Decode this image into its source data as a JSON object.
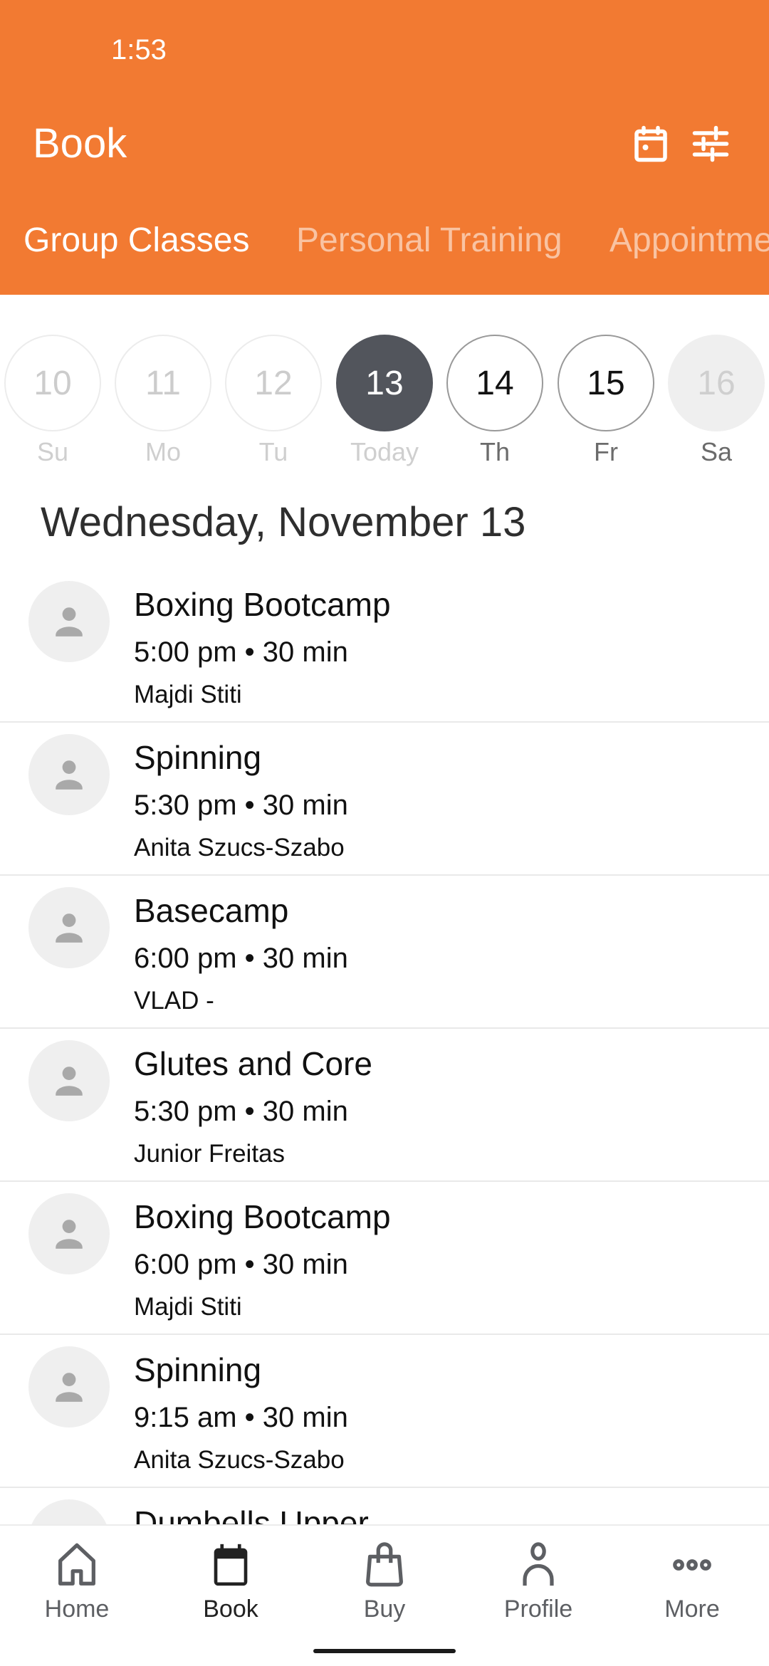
{
  "status_bar": {
    "time": "1:53"
  },
  "header": {
    "title": "Book",
    "icons": [
      "calendar-icon",
      "filter-sliders-icon"
    ],
    "accent_color": "#f27a32"
  },
  "tabs": [
    {
      "label": "Group Classes",
      "active": true
    },
    {
      "label": "Personal Training",
      "active": false
    },
    {
      "label": "Appointme",
      "active": false
    }
  ],
  "week": [
    {
      "num": "10",
      "label": "Su",
      "state": "past"
    },
    {
      "num": "11",
      "label": "Mo",
      "state": "past"
    },
    {
      "num": "12",
      "label": "Tu",
      "state": "past"
    },
    {
      "num": "13",
      "label": "Today",
      "state": "selected"
    },
    {
      "num": "14",
      "label": "Th",
      "state": "future"
    },
    {
      "num": "15",
      "label": "Fr",
      "state": "future"
    },
    {
      "num": "16",
      "label": "Sa",
      "state": "unavailable"
    }
  ],
  "date_heading": "Wednesday, November 13",
  "classes": [
    {
      "name": "Boxing Bootcamp",
      "time": "5:00 pm • 30 min",
      "instructor": "Majdi Stiti"
    },
    {
      "name": "Spinning",
      "time": "5:30 pm • 30 min",
      "instructor": "Anita Szucs-Szabo"
    },
    {
      "name": "Basecamp",
      "time": "6:00 pm • 30 min",
      "instructor": "VLAD -"
    },
    {
      "name": "Glutes and Core",
      "time": "5:30 pm • 30 min",
      "instructor": "Junior Freitas"
    },
    {
      "name": "Boxing Bootcamp",
      "time": "6:00 pm • 30 min",
      "instructor": "Majdi Stiti"
    },
    {
      "name": "Spinning",
      "time": "9:15 am • 30 min",
      "instructor": "Anita Szucs-Szabo"
    },
    {
      "name": "Dumbells Upper",
      "time": "",
      "instructor": ""
    }
  ],
  "bottom_nav": [
    {
      "label": "Home",
      "icon": "home-icon",
      "active": false
    },
    {
      "label": "Book",
      "icon": "calendar-icon",
      "active": true
    },
    {
      "label": "Buy",
      "icon": "shopping-bag-icon",
      "active": false
    },
    {
      "label": "Profile",
      "icon": "person-icon",
      "active": false
    },
    {
      "label": "More",
      "icon": "more-dots-icon",
      "active": false
    }
  ]
}
